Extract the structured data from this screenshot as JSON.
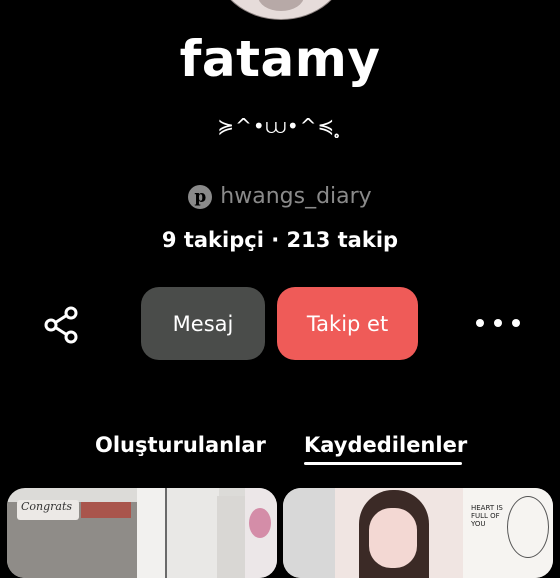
{
  "profile": {
    "name": "fatamy",
    "bio": "≽^•⩊•^≼ ̥̥̥̥",
    "website": "hwangs_diary",
    "followers_text": "9 takipçi · 213 takip"
  },
  "actions": {
    "message_label": "Mesaj",
    "follow_label": "Takip et"
  },
  "tabs": {
    "created_label": "Oluşturulanlar",
    "saved_label": "Kaydedilenler",
    "active": "saved"
  },
  "pins": {
    "first_card_text": "Congrats",
    "second_card_text": "HEART IS FULL OF YOU"
  },
  "icons": {
    "share": "share-icon",
    "more": "more-dots-icon",
    "website": "pinterest-icon"
  },
  "colors": {
    "primary": "#ef5b58",
    "secondary": "#4a4c4a",
    "background": "#000000"
  }
}
